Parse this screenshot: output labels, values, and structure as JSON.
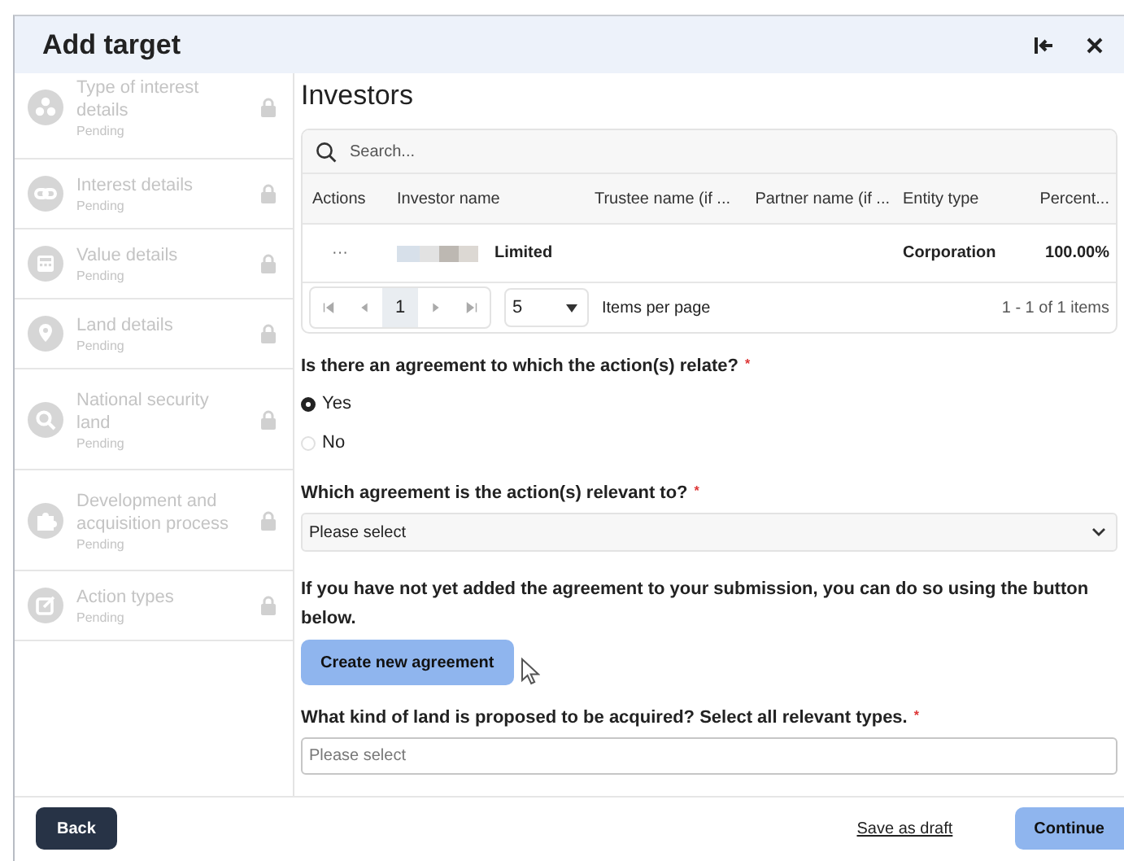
{
  "window": {
    "title": "Add target"
  },
  "sidebar": {
    "items": [
      {
        "title": "Type of interest details",
        "status": "Pending",
        "locked": true
      },
      {
        "title": "Interest details",
        "status": "Pending",
        "locked": true
      },
      {
        "title": "Value details",
        "status": "Pending",
        "locked": true
      },
      {
        "title": "Land details",
        "status": "Pending",
        "locked": true
      },
      {
        "title": "National security land",
        "status": "Pending",
        "locked": true
      },
      {
        "title": "Development and acquisition process",
        "status": "Pending",
        "locked": true
      },
      {
        "title": "Action types",
        "status": "Pending",
        "locked": true
      }
    ]
  },
  "investors": {
    "heading": "Investors",
    "search": {
      "placeholder": "Search..."
    },
    "columns": [
      "Actions",
      "Investor name",
      "Trustee name (if ...",
      "Partner name (if ...",
      "Entity type",
      "Percent..."
    ],
    "rows": [
      {
        "actions": "···",
        "investor_name": "Limited",
        "entity_type": "Corporation",
        "percent": "100.00%"
      }
    ],
    "pager": {
      "page": "1",
      "page_size": "5",
      "page_size_label": "Items per page",
      "summary": "1 - 1 of 1 items"
    }
  },
  "form": [
    {
      "kind": "radio",
      "label": "Is there an agreement to which the action(s) relate?",
      "required_mark": "*",
      "options": [
        {
          "label": "Yes",
          "selected": true
        },
        {
          "label": "No",
          "selected": false
        }
      ]
    },
    {
      "kind": "select",
      "label": "Which agreement is the action(s) relevant to?",
      "required_mark": "*",
      "placeholder": "Please select"
    },
    {
      "kind": "note",
      "text": "If you have not yet added the agreement to your submission, you can do so using the button below.",
      "button": "Create new agreement"
    },
    {
      "kind": "multiselect",
      "label": "What kind of land is proposed to be acquired? Select all relevant types.",
      "required_mark": "*",
      "placeholder": "Please select"
    }
  ],
  "footer": {
    "back": "Back",
    "save": "Save as draft",
    "continue": "Continue"
  }
}
